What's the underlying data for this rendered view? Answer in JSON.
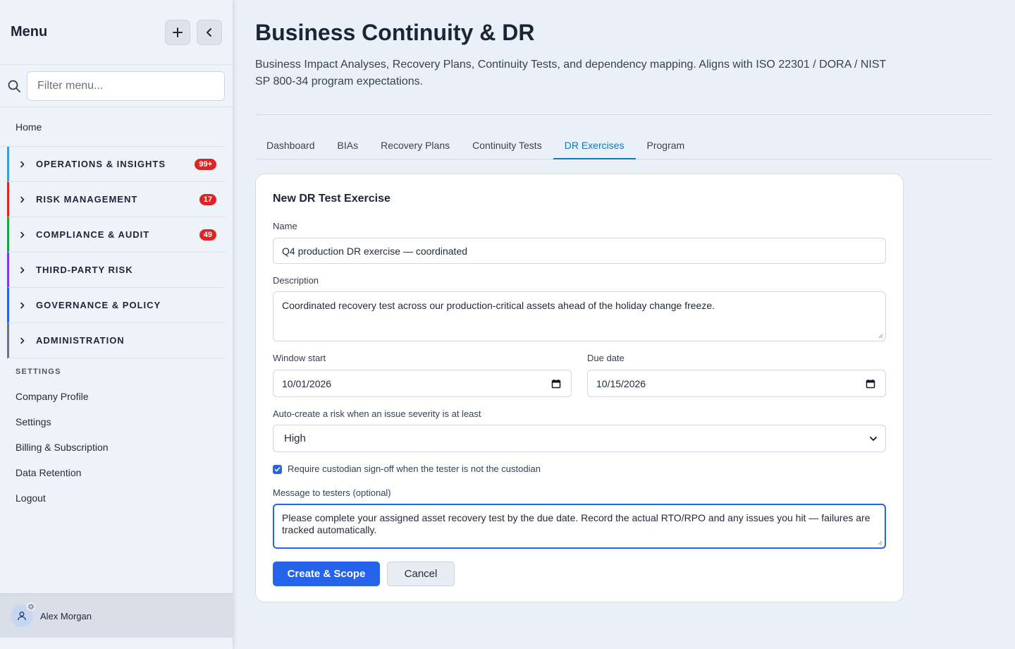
{
  "sidebar": {
    "title": "Menu",
    "filter_placeholder": "Filter menu...",
    "home": "Home",
    "groups": [
      {
        "label": "OPERATIONS & INSIGHTS",
        "badge": "99+",
        "color": "#3b9fd1"
      },
      {
        "label": "RISK MANAGEMENT",
        "badge": "17",
        "color": "#dc2626"
      },
      {
        "label": "COMPLIANCE & AUDIT",
        "badge": "49",
        "color": "#16a34a"
      },
      {
        "label": "THIRD-PARTY RISK",
        "badge": "",
        "color": "#7c3aed"
      },
      {
        "label": "GOVERNANCE & POLICY",
        "badge": "",
        "color": "#2563eb"
      },
      {
        "label": "ADMINISTRATION",
        "badge": "",
        "color": "#6b7280"
      }
    ],
    "settings_heading": "SETTINGS",
    "settings_links": [
      "Company Profile",
      "Settings",
      "Billing & Subscription",
      "Data Retention",
      "Logout"
    ],
    "user_name": "Alex Morgan"
  },
  "page": {
    "title": "Business Continuity & DR",
    "description": "Business Impact Analyses, Recovery Plans, Continuity Tests, and dependency mapping. Aligns with ISO 22301 / DORA / NIST SP 800-34 program expectations.",
    "tabs": [
      "Dashboard",
      "BIAs",
      "Recovery Plans",
      "Continuity Tests",
      "DR Exercises",
      "Program"
    ],
    "active_tab": "DR Exercises"
  },
  "form": {
    "title": "New DR Test Exercise",
    "name_label": "Name",
    "name_value": "Q4 production DR exercise — coordinated",
    "description_label": "Description",
    "description_value": "Coordinated recovery test across our production-critical assets ahead of the holiday change freeze.",
    "window_start_label": "Window start",
    "window_start_value": "10/01/2026",
    "due_date_label": "Due date",
    "due_date_value": "10/15/2026",
    "severity_label": "Auto-create a risk when an issue severity is at least",
    "severity_value": "High",
    "signoff_label": "Require custodian sign-off when the tester is not the custodian",
    "signoff_checked": true,
    "message_label": "Message to testers (optional)",
    "message_value": "Please complete your assigned asset recovery test by the due date. Record the actual RTO/RPO and any issues you hit — failures are tracked automatically.",
    "create_label": "Create & Scope",
    "cancel_label": "Cancel"
  }
}
